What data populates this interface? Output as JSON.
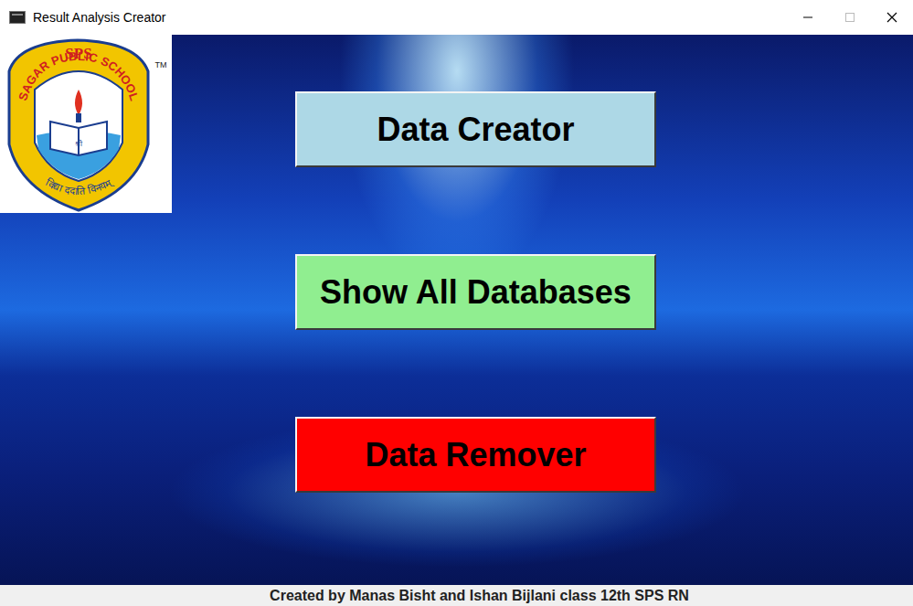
{
  "window": {
    "title": "Result Analysis Creator"
  },
  "logo": {
    "abbr": "SPS",
    "name": "SAGAR PUBLIC SCHOOL",
    "motto": "विद्या ददाति विनयम्",
    "book": "श्री",
    "trademark": "TM"
  },
  "buttons": [
    {
      "label": "Data Creator",
      "color": "#add8e6"
    },
    {
      "label": "Show All Databases",
      "color": "#90ee90"
    },
    {
      "label": "Data Remover",
      "color": "#ff0000"
    }
  ],
  "footer": "Created by Manas Bisht and Ishan Bijlani class 12th SPS RN"
}
